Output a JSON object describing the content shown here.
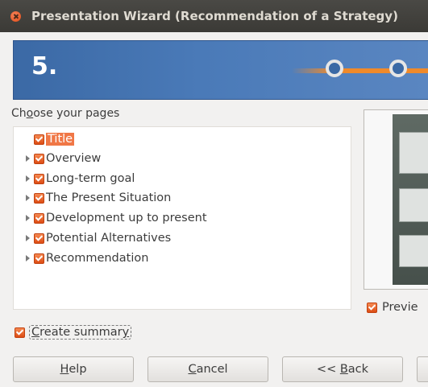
{
  "window": {
    "title": "Presentation Wizard (Recommendation of a Strategy)"
  },
  "banner": {
    "step": "5."
  },
  "pages": {
    "label_prefix": "Ch",
    "label_accel": "o",
    "label_suffix": "ose your pages",
    "items": [
      {
        "label": "Title",
        "selected": true,
        "expandable": false
      },
      {
        "label": "Overview",
        "expandable": true
      },
      {
        "label": "Long-term goal",
        "expandable": true
      },
      {
        "label": "The Present Situation",
        "expandable": true
      },
      {
        "label": "Development up to present",
        "expandable": true
      },
      {
        "label": "Potential Alternatives",
        "expandable": true
      },
      {
        "label": "Recommendation",
        "expandable": true
      }
    ]
  },
  "preview": {
    "checkbox_label": "Previe"
  },
  "summary": {
    "prefix": "",
    "accel": "C",
    "middle": "reate summar",
    "accel2": "y",
    "checked": true
  },
  "buttons": {
    "help_accel": "H",
    "help_rest": "elp",
    "cancel_accel": "C",
    "cancel_rest": "ancel",
    "back_prefix": "<< ",
    "back_accel": "B",
    "back_rest": "ack"
  },
  "colors": {
    "accent": "#f07746",
    "banner": "#4a7ab8",
    "progress": "#f08a2a"
  }
}
